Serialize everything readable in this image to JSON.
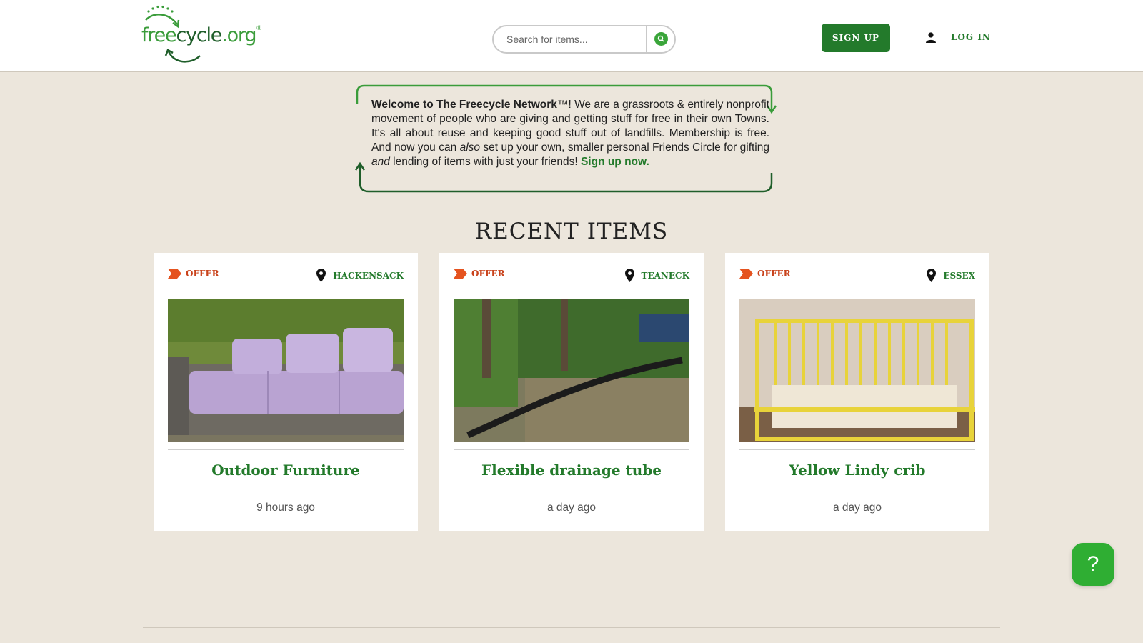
{
  "header": {
    "logo": {
      "part1": "free",
      "part2": "cycle",
      "part3": ".org",
      "reg": "®"
    },
    "search": {
      "placeholder": "Search for items..."
    },
    "signup_label": "SIGN UP",
    "login_label": "LOG IN"
  },
  "welcome": {
    "title": "Welcome to The Freecycle Network",
    "tm": "™",
    "text1": "! We are a grassroots & entirely nonprofit movement of people who are giving and getting stuff for free in their own Towns. It's all about reuse and keeping good stuff out of landfills. Membership is free. And now you can ",
    "also": "also",
    "text2": " set up your own, smaller personal Friends Circle for gifting ",
    "and": "and",
    "text3": " lending of items with just your friends! ",
    "link": "Sign up now."
  },
  "recent": {
    "title": "RECENT ITEMS",
    "items": [
      {
        "type": "OFFER",
        "location": "HACKENSACK",
        "title": "Outdoor Furniture",
        "time": "9 hours ago",
        "image": "purple-outdoor-sofa-photo"
      },
      {
        "type": "OFFER",
        "location": "TEANECK",
        "title": "Flexible drainage tube",
        "time": "a day ago",
        "image": "drainage-tube-in-yard-photo"
      },
      {
        "type": "OFFER",
        "location": "ESSEX",
        "title": "Yellow Lindy crib",
        "time": "a day ago",
        "image": "yellow-crib-photo"
      }
    ]
  },
  "help": {
    "label": "?"
  },
  "colors": {
    "brand_green": "#237a2b",
    "offer_orange": "#c9431c",
    "page_bg": "#ece6dc"
  }
}
